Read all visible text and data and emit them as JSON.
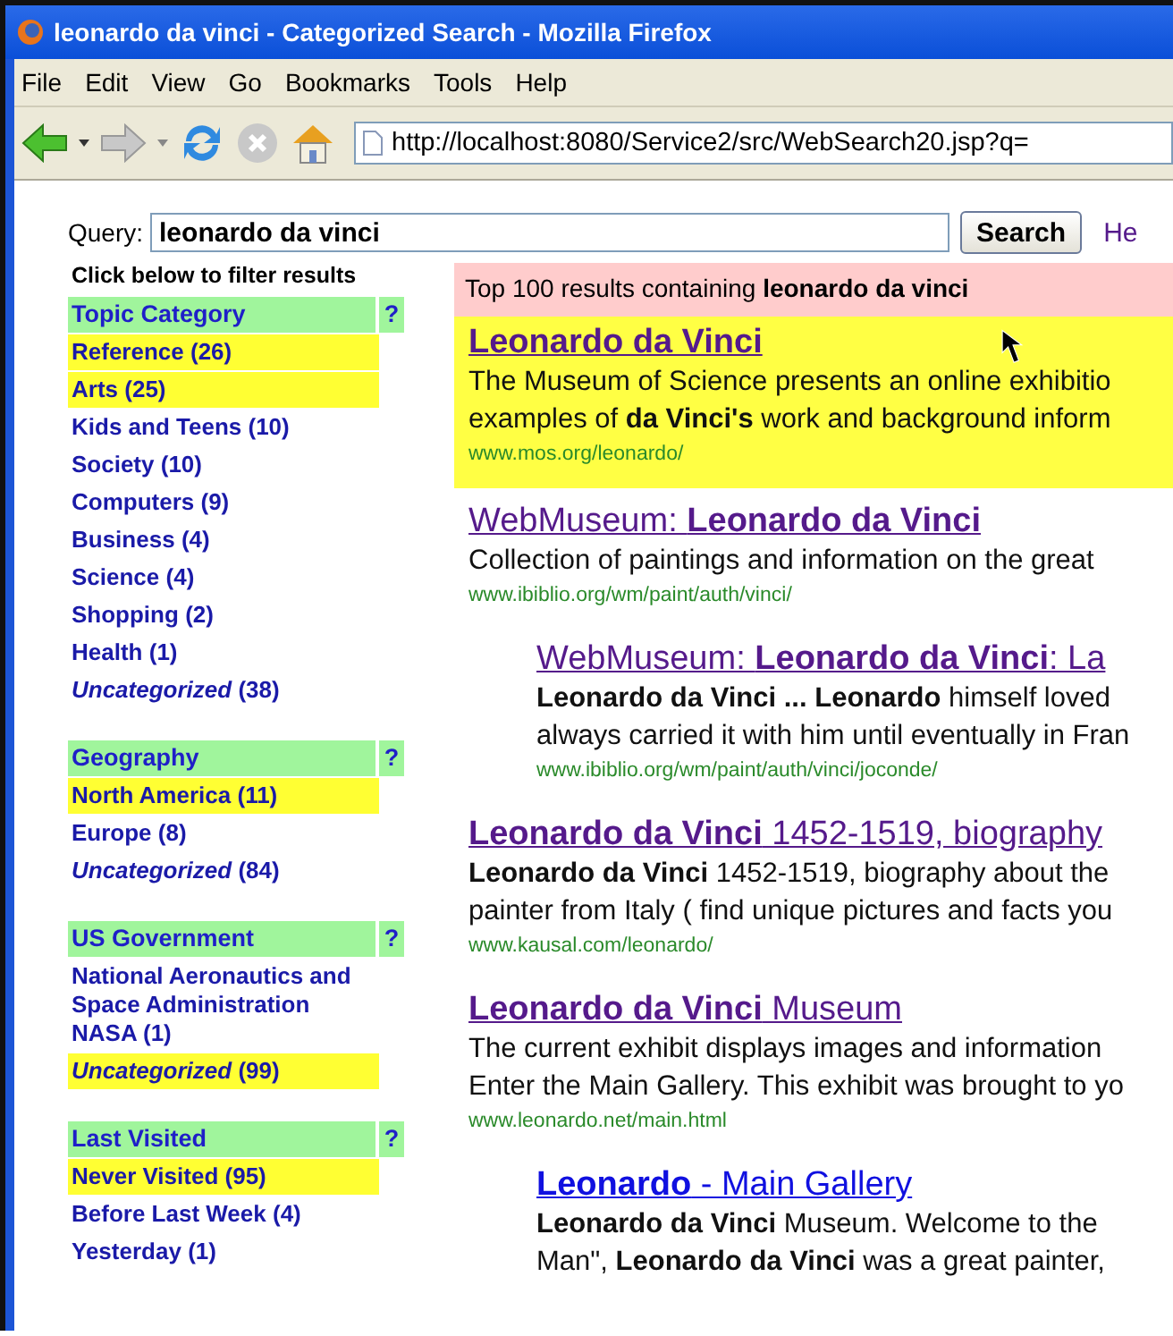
{
  "window": {
    "title": "leonardo da vinci - Categorized Search - Mozilla Firefox"
  },
  "menu": [
    "File",
    "Edit",
    "View",
    "Go",
    "Bookmarks",
    "Tools",
    "Help"
  ],
  "address": "http://localhost:8080/Service2/src/WebSearch20.jsp?q=",
  "query": {
    "label": "Query:",
    "value": "leonardo da vinci",
    "button": "Search",
    "help_link": "He"
  },
  "sidebar": {
    "heading": "Click below to filter results",
    "groups": [
      {
        "title": "Topic Category",
        "help": "?",
        "items": [
          {
            "label": "Reference",
            "count": "(26)",
            "kind": "category",
            "highlighted": true
          },
          {
            "label": "Arts",
            "count": "(25)",
            "kind": "category",
            "highlighted": true
          },
          {
            "label": "Kids and Teens",
            "count": "(10)",
            "kind": "category",
            "highlighted": false
          },
          {
            "label": "Society",
            "count": "(10)",
            "kind": "category",
            "highlighted": false
          },
          {
            "label": "Computers",
            "count": "(9)",
            "kind": "category",
            "highlighted": false
          },
          {
            "label": "Business",
            "count": "(4)",
            "kind": "category",
            "highlighted": false
          },
          {
            "label": "Science",
            "count": "(4)",
            "kind": "category",
            "highlighted": false
          },
          {
            "label": "Shopping",
            "count": "(2)",
            "kind": "category",
            "highlighted": false
          },
          {
            "label": "Health",
            "count": "(1)",
            "kind": "category",
            "highlighted": false
          },
          {
            "label": "Uncategorized",
            "count": "(38)",
            "kind": "uncategorized",
            "highlighted": false
          }
        ]
      },
      {
        "title": "Geography",
        "help": "?",
        "items": [
          {
            "label": "North America",
            "count": "(11)",
            "kind": "category",
            "highlighted": true
          },
          {
            "label": "Europe",
            "count": "(8)",
            "kind": "category",
            "highlighted": false
          },
          {
            "label": "Uncategorized",
            "count": "(84)",
            "kind": "uncategorized",
            "highlighted": false
          }
        ]
      },
      {
        "title": "US Government",
        "help": "?",
        "items": [
          {
            "label": "National Aeronautics and Space Administration NASA",
            "count": "(1)",
            "kind": "category",
            "highlighted": false
          },
          {
            "label": "Uncategorized",
            "count": "(99)",
            "kind": "uncategorized",
            "highlighted": true
          }
        ]
      },
      {
        "title": "Last Visited",
        "help": "?",
        "items": [
          {
            "label": "Never Visited",
            "count": "(95)",
            "kind": "category",
            "highlighted": true
          },
          {
            "label": "Before Last Week",
            "count": "(4)",
            "kind": "category",
            "highlighted": false
          },
          {
            "label": "Yesterday",
            "count": "(1)",
            "kind": "category",
            "highlighted": false
          }
        ]
      }
    ]
  },
  "results": {
    "summary": "Top 100 results containing **leonardo da vinci**",
    "items": [
      {
        "title": "**Leonardo da Vinci**",
        "lines": [
          "The Museum of Science presents an online exhibitio",
          "examples of **da Vinci's** work and background inform"
        ],
        "url": "www.mos.org/leonardo/",
        "highlighted": true,
        "visited": true
      },
      {
        "title": "WebMuseum: **Leonardo da Vinci**",
        "lines": [
          "Collection of paintings and information on the great"
        ],
        "url": "www.ibiblio.org/wm/paint/auth/vinci/",
        "highlighted": false,
        "visited": true,
        "children": [
          {
            "title": "WebMuseum: **Leonardo da Vinci**: La",
            "lines": [
              "**Leonardo da Vinci ... Leonardo** himself loved",
              "always carried it with him until eventually in Fran"
            ],
            "url": "www.ibiblio.org/wm/paint/auth/vinci/joconde/",
            "highlighted": false,
            "visited": true
          }
        ]
      },
      {
        "title": "**Leonardo da Vinci** 1452-1519, biography",
        "lines": [
          "**Leonardo da Vinci** 1452-1519, biography about the",
          "painter from Italy ( find unique pictures and facts you"
        ],
        "url": "www.kausal.com/leonardo/",
        "highlighted": false,
        "visited": true
      },
      {
        "title": "**Leonardo da Vinci** Museum",
        "lines": [
          "The current exhibit displays images and information",
          "Enter the Main Gallery. This exhibit was brought to yo"
        ],
        "url": "www.leonardo.net/main.html",
        "highlighted": false,
        "visited": true,
        "children": [
          {
            "title": "**Leonardo** - Main Gallery",
            "lines": [
              "**Leonardo da Vinci** Museum. Welcome to the",
              "Man\", **Leonardo da Vinci** was a great painter,"
            ],
            "highlighted": false,
            "visited": false
          }
        ]
      }
    ]
  }
}
